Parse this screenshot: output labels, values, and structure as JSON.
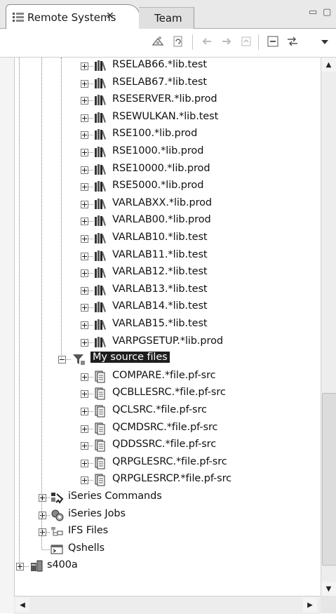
{
  "tabs": {
    "active_label": "Remote Systems",
    "close_glyph": "✕",
    "inactive_label": "Team"
  },
  "window_controls": {
    "minimize": "▭",
    "maximize": "▢"
  },
  "toolbar": {
    "icons": [
      "new-connection-icon",
      "refresh-icon",
      "back-arrow-icon",
      "forward-arrow-icon",
      "home-icon",
      "collapse-all-icon",
      "link-with-editor-icon",
      "view-menu-icon"
    ]
  },
  "tree": {
    "libraries": [
      "RSELAB66.*lib.test",
      "RSELAB67.*lib.test",
      "RSESERVER.*lib.prod",
      "RSEWULKAN.*lib.test",
      "RSE100.*lib.prod",
      "RSE1000.*lib.prod",
      "RSE10000.*lib.prod",
      "RSE5000.*lib.prod",
      "VARLABXX.*lib.prod",
      "VARLAB00.*lib.prod",
      "VARLAB10.*lib.test",
      "VARLAB11.*lib.test",
      "VARLAB12.*lib.test",
      "VARLAB13.*lib.test",
      "VARLAB14.*lib.test",
      "VARLAB15.*lib.test",
      "VARPGSETUP.*lib.prod"
    ],
    "filter_pool": "My source files",
    "source_files": [
      "COMPARE.*file.pf-src",
      "QCBLLESRC.*file.pf-src",
      "QCLSRC.*file.pf-src",
      "QCMDSRC.*file.pf-src",
      "QDDSSRC.*file.pf-src",
      "QRPGLESRC.*file.pf-src",
      "QRPGLESRCP.*file.pf-src"
    ],
    "subsystems": [
      "iSeries Commands",
      "iSeries Jobs",
      "IFS Files",
      "Qshells"
    ],
    "connection": "s400a"
  },
  "scrollbar": {
    "up": "▲",
    "down": "▼",
    "left": "◀",
    "right": "▶"
  }
}
